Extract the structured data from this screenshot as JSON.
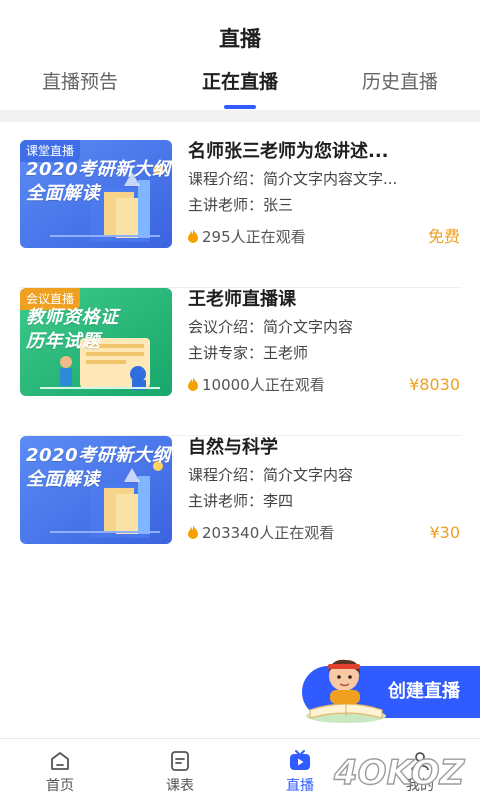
{
  "header": {
    "title": "直播"
  },
  "tabs": [
    {
      "label": "直播预告"
    },
    {
      "label": "正在直播"
    },
    {
      "label": "历史直播"
    }
  ],
  "cards": [
    {
      "thumb_tag": "课堂直播",
      "thumb_text_line1": "2020考研新大纲",
      "thumb_text_line2": "全面解读",
      "title": "名师张三老师为您讲述...",
      "line1_label": "课程介绍：",
      "line1_value": "简介文字内容文字...",
      "line2_label": "主讲老师：",
      "line2_value": "张三",
      "viewers": "295人正在观看",
      "price": "免费"
    },
    {
      "thumb_tag": "会议直播",
      "thumb_text_line1": "教师资格证",
      "thumb_text_line2": "历年试题",
      "title": "王老师直播课",
      "line1_label": "会议介绍：",
      "line1_value": "简介文字内容",
      "line2_label": "主讲专家：",
      "line2_value": "王老师",
      "viewers": "10000人正在观看",
      "price": "¥8030"
    },
    {
      "thumb_tag": "",
      "thumb_text_line1": "2020考研新大纲",
      "thumb_text_line2": "全面解读",
      "title": "自然与科学",
      "line1_label": "课程介绍：",
      "line1_value": "简介文字内容",
      "line2_label": "主讲老师：",
      "line2_value": "李四",
      "viewers": "203340人正在观看",
      "price": "¥30"
    }
  ],
  "fab": {
    "label": "创建直播"
  },
  "tabbar": [
    {
      "label": "首页",
      "icon": "home-icon"
    },
    {
      "label": "课表",
      "icon": "schedule-icon"
    },
    {
      "label": "直播",
      "icon": "live-tv-icon"
    },
    {
      "label": "我的",
      "icon": "user-icon"
    }
  ],
  "watermark": {
    "text": "4OKOZ"
  },
  "colors": {
    "accent": "#2f5bff",
    "price": "#f0a020",
    "fire": "#f5a000",
    "divider_band": "#f2f2f2"
  }
}
